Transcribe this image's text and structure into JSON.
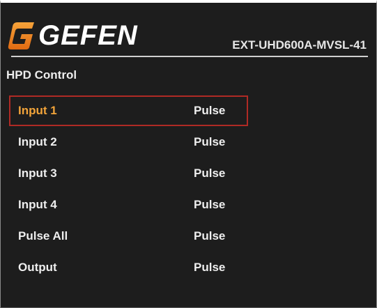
{
  "header": {
    "brand": "GEFEN",
    "brand_icon": "gefen-g-logo-icon",
    "brand_color": "#f28a1e",
    "model": "EXT-UHD600A-MVSL-41"
  },
  "menu": {
    "title": "HPD Control",
    "selected_color": "#f2a43a",
    "selection_border_color": "#b02a25",
    "items": [
      {
        "label": "Input 1",
        "value": "Pulse",
        "selected": true
      },
      {
        "label": "Input 2",
        "value": "Pulse",
        "selected": false
      },
      {
        "label": "Input 3",
        "value": "Pulse",
        "selected": false
      },
      {
        "label": "Input 4",
        "value": "Pulse",
        "selected": false
      },
      {
        "label": "Pulse All",
        "value": "Pulse",
        "selected": false
      },
      {
        "label": "Output",
        "value": "Pulse",
        "selected": false
      }
    ]
  }
}
